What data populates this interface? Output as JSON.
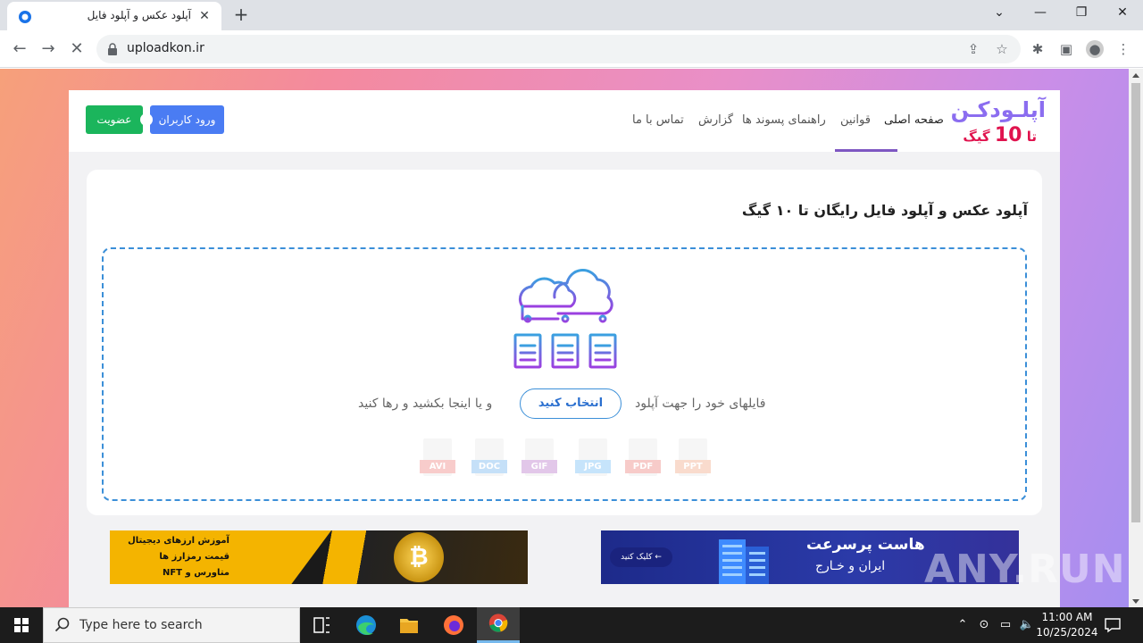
{
  "browser": {
    "tab_title": "آپلود عکس و آپلود فایل",
    "url": "uploadkon.ir",
    "tab_close": "✕",
    "new_tab": "+"
  },
  "site": {
    "logo_main": "آپلـودکـن",
    "logo_sub_prefix": "تا",
    "logo_sub_number": "10",
    "logo_sub_suffix": "گیگ",
    "nav": {
      "home": "صفحه اصلی",
      "rules": "قوانین",
      "guide": "راهنمای پسوند ها",
      "report": "گزارش",
      "contact": "تماس با ما"
    },
    "login_button": "ورود کاربران",
    "join_button": "عضویت"
  },
  "upload": {
    "title": "آپلود عکس و آپلود فایل رایگان تا ۱۰ گیگ",
    "drop_text_right": "فایلهای خود را جهت آپلود",
    "select_button": "انتخاب کنید",
    "drop_text_left": "و یا اینجا بکشید و رها کنید",
    "file_types": [
      "PPT",
      "PDF",
      "JPG",
      "GIF",
      "DOC",
      "AVI"
    ]
  },
  "ads": {
    "crypto": {
      "line1": "آموزش ارزهای دیجیتال",
      "line2": "قیمت رمزارز ها",
      "line3": "متاورس و NFT"
    },
    "hosting": {
      "headline": "هاست پرسرعت",
      "sub": "ایران و خـارج",
      "cta": "کلیک کنید"
    }
  },
  "watermark": "ANY.RUN",
  "taskbar": {
    "search_placeholder": "Type here to search",
    "time": "11:00 AM",
    "date": "10/25/2024"
  },
  "colors": {
    "accent_purple": "#8b6df0",
    "logo_red": "#e0134e",
    "login_blue": "#4a7cf3",
    "join_green": "#1bb55c",
    "dropzone_blue": "#3b8fd8"
  }
}
